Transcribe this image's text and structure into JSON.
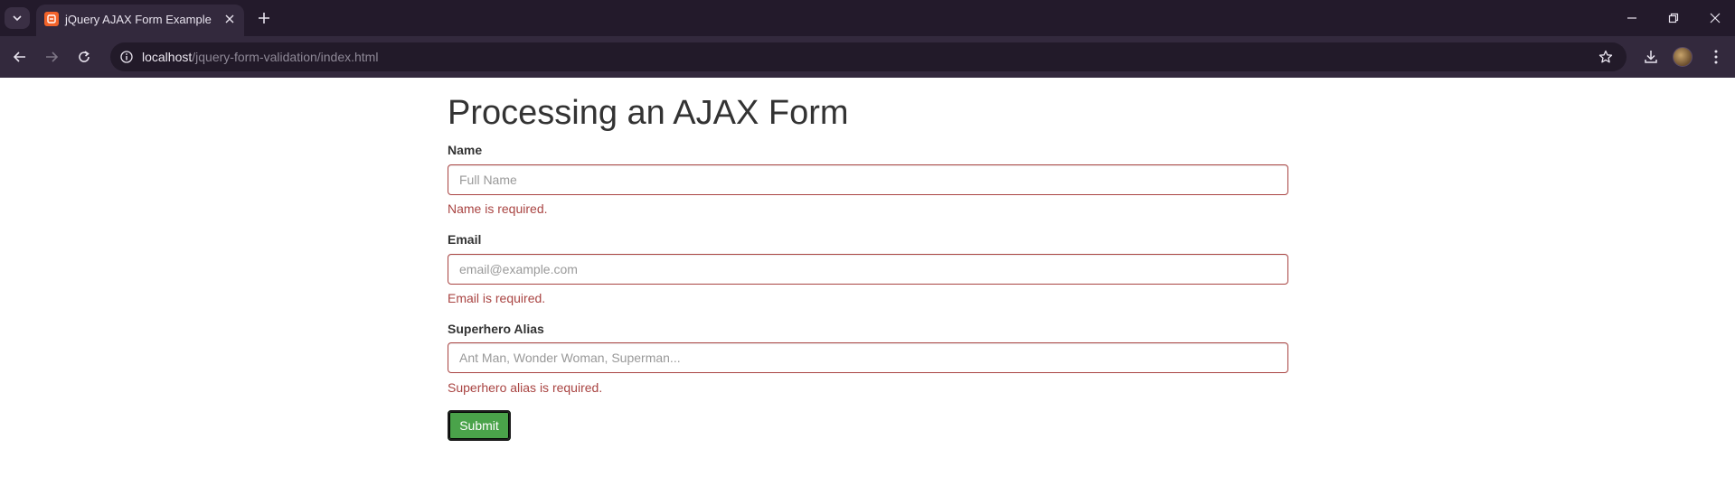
{
  "browser": {
    "tab": {
      "title": "jQuery AJAX Form Example"
    },
    "address_bar": {
      "host": "localhost",
      "path": "/jquery-form-validation/index.html"
    }
  },
  "page": {
    "heading": "Processing an AJAX Form",
    "fields": [
      {
        "label": "Name",
        "placeholder": "Full Name",
        "error": "Name is required."
      },
      {
        "label": "Email",
        "placeholder": "email@example.com",
        "error": "Email is required."
      },
      {
        "label": "Superhero Alias",
        "placeholder": "Ant Man, Wonder Woman, Superman...",
        "error": "Superhero alias is required."
      }
    ],
    "submit_label": "Submit"
  },
  "colors": {
    "error": "#a94442",
    "submit": "#4aa34a",
    "chrome_dark": "#231a2b",
    "toolbar": "#33293d"
  },
  "icons": [
    "tab-search-icon",
    "favicon-icon",
    "close-icon",
    "plus-icon",
    "minimize-icon",
    "restore-icon",
    "close-window-icon",
    "back-icon",
    "forward-icon",
    "reload-icon",
    "site-info-icon",
    "star-icon",
    "download-icon",
    "kebab-menu-icon"
  ]
}
